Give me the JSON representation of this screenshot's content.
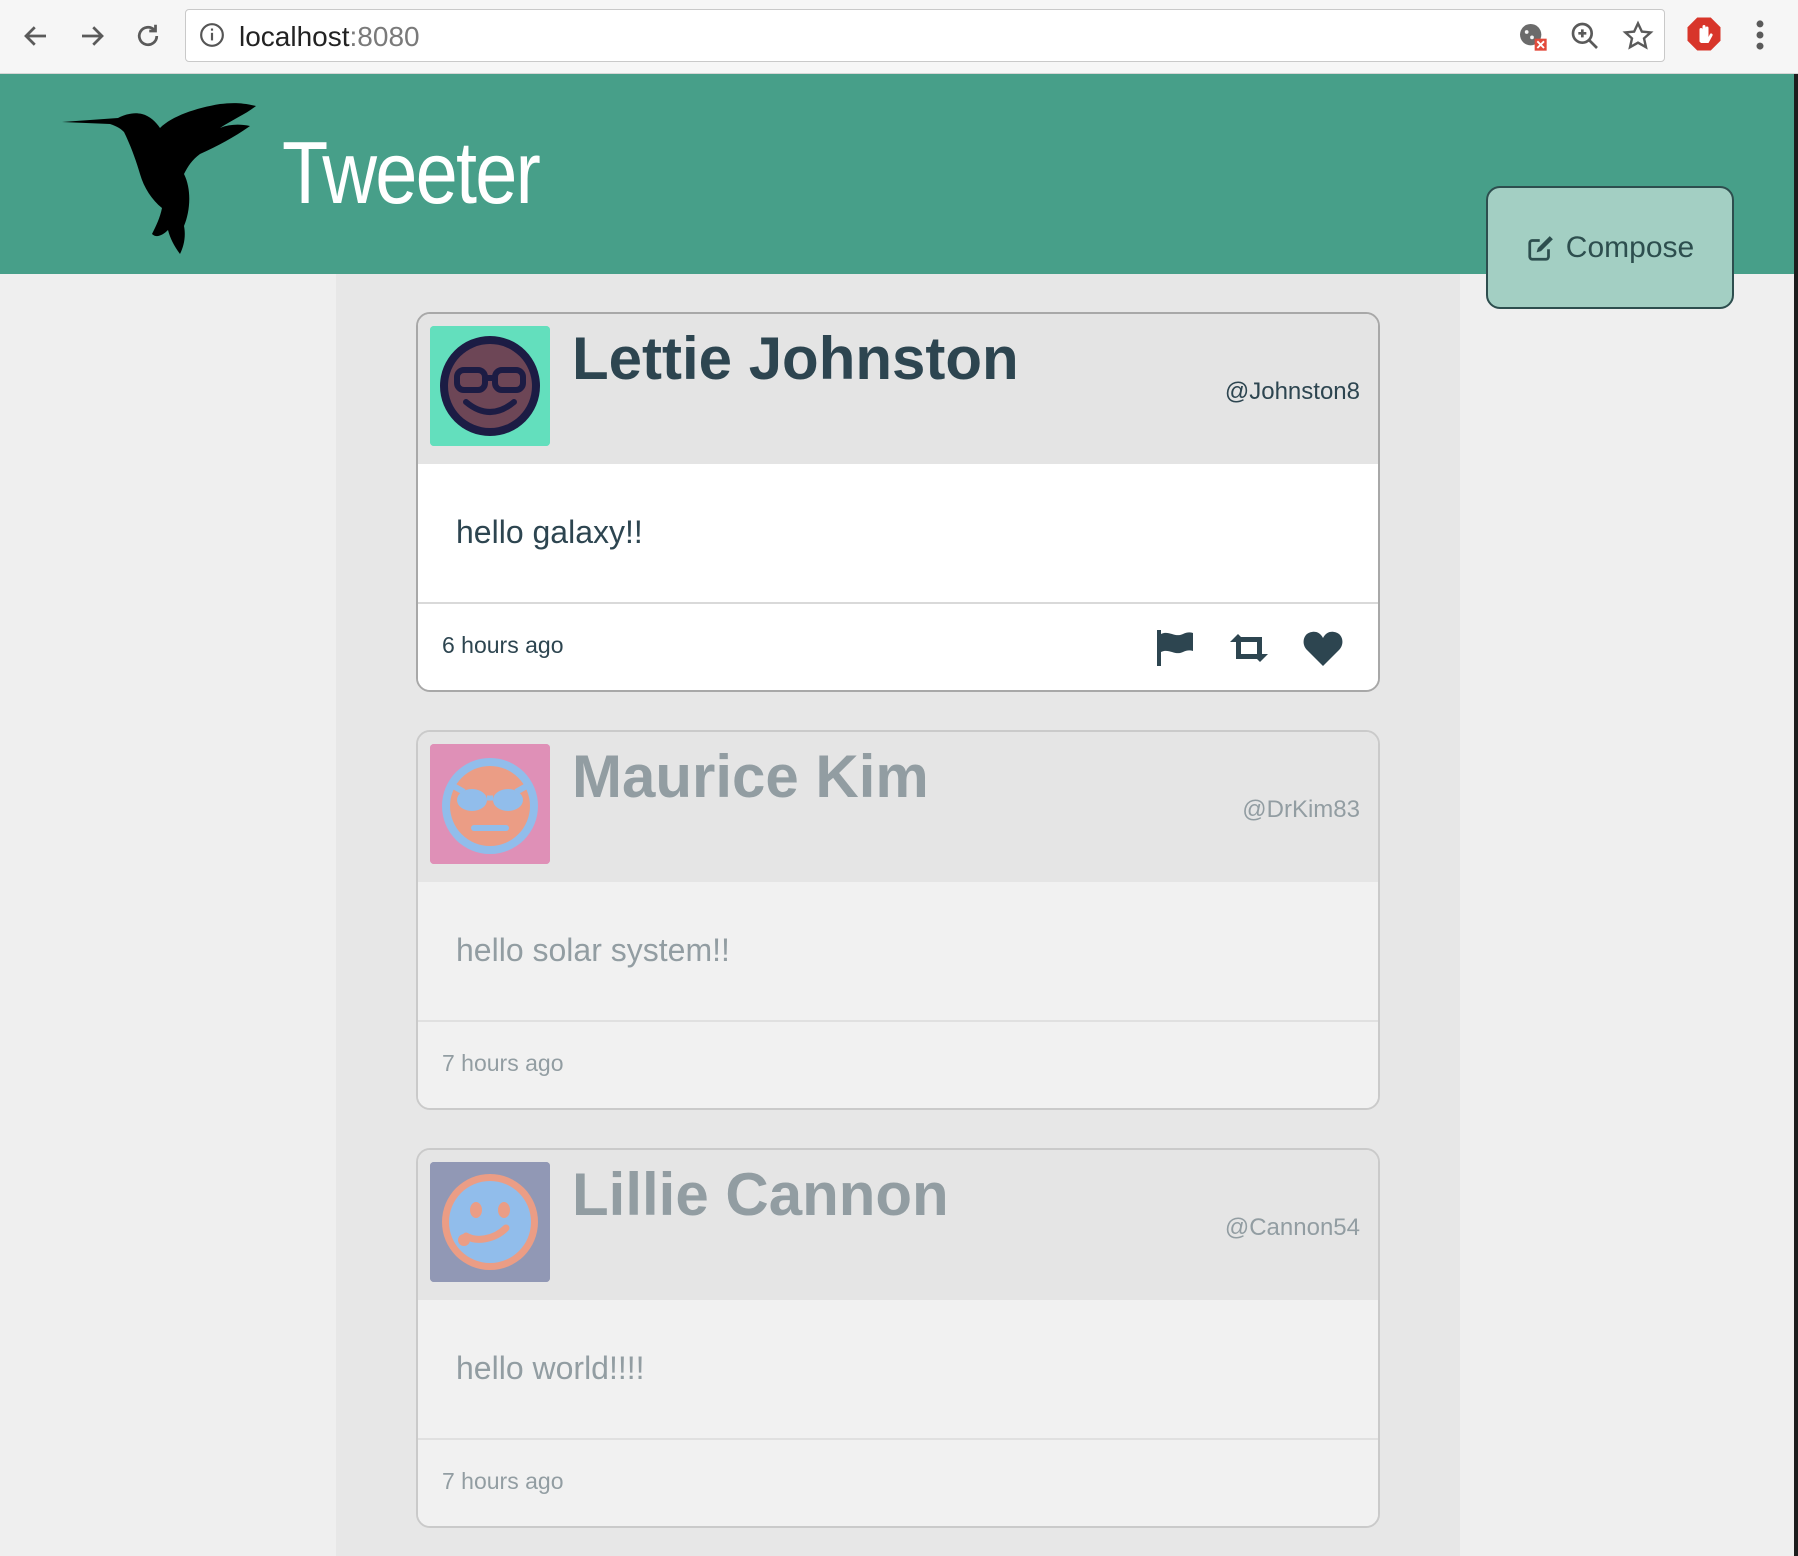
{
  "browser": {
    "url_host": "localhost",
    "url_port": ":8080"
  },
  "app": {
    "brand": "Tweeter",
    "compose_label": "Compose",
    "accent_color": "#479f89"
  },
  "tweets": [
    {
      "name": "Lettie Johnston",
      "handle": "@Johnston8",
      "text": "hello galaxy!!",
      "time": "6 hours ago",
      "avatar_bg": "#63dfbd",
      "avatar_icon": "nerd-face-icon",
      "faded": false
    },
    {
      "name": "Maurice Kim",
      "handle": "@DrKim83",
      "text": "hello solar system!!",
      "time": "7 hours ago",
      "avatar_bg": "#d6297f",
      "avatar_icon": "cool-face-icon",
      "faded": true
    },
    {
      "name": "Lillie Cannon",
      "handle": "@Cannon54",
      "text": "hello world!!!!",
      "time": "7 hours ago",
      "avatar_bg": "#2b3a7a",
      "avatar_icon": "smirk-face-icon",
      "faded": true
    }
  ]
}
